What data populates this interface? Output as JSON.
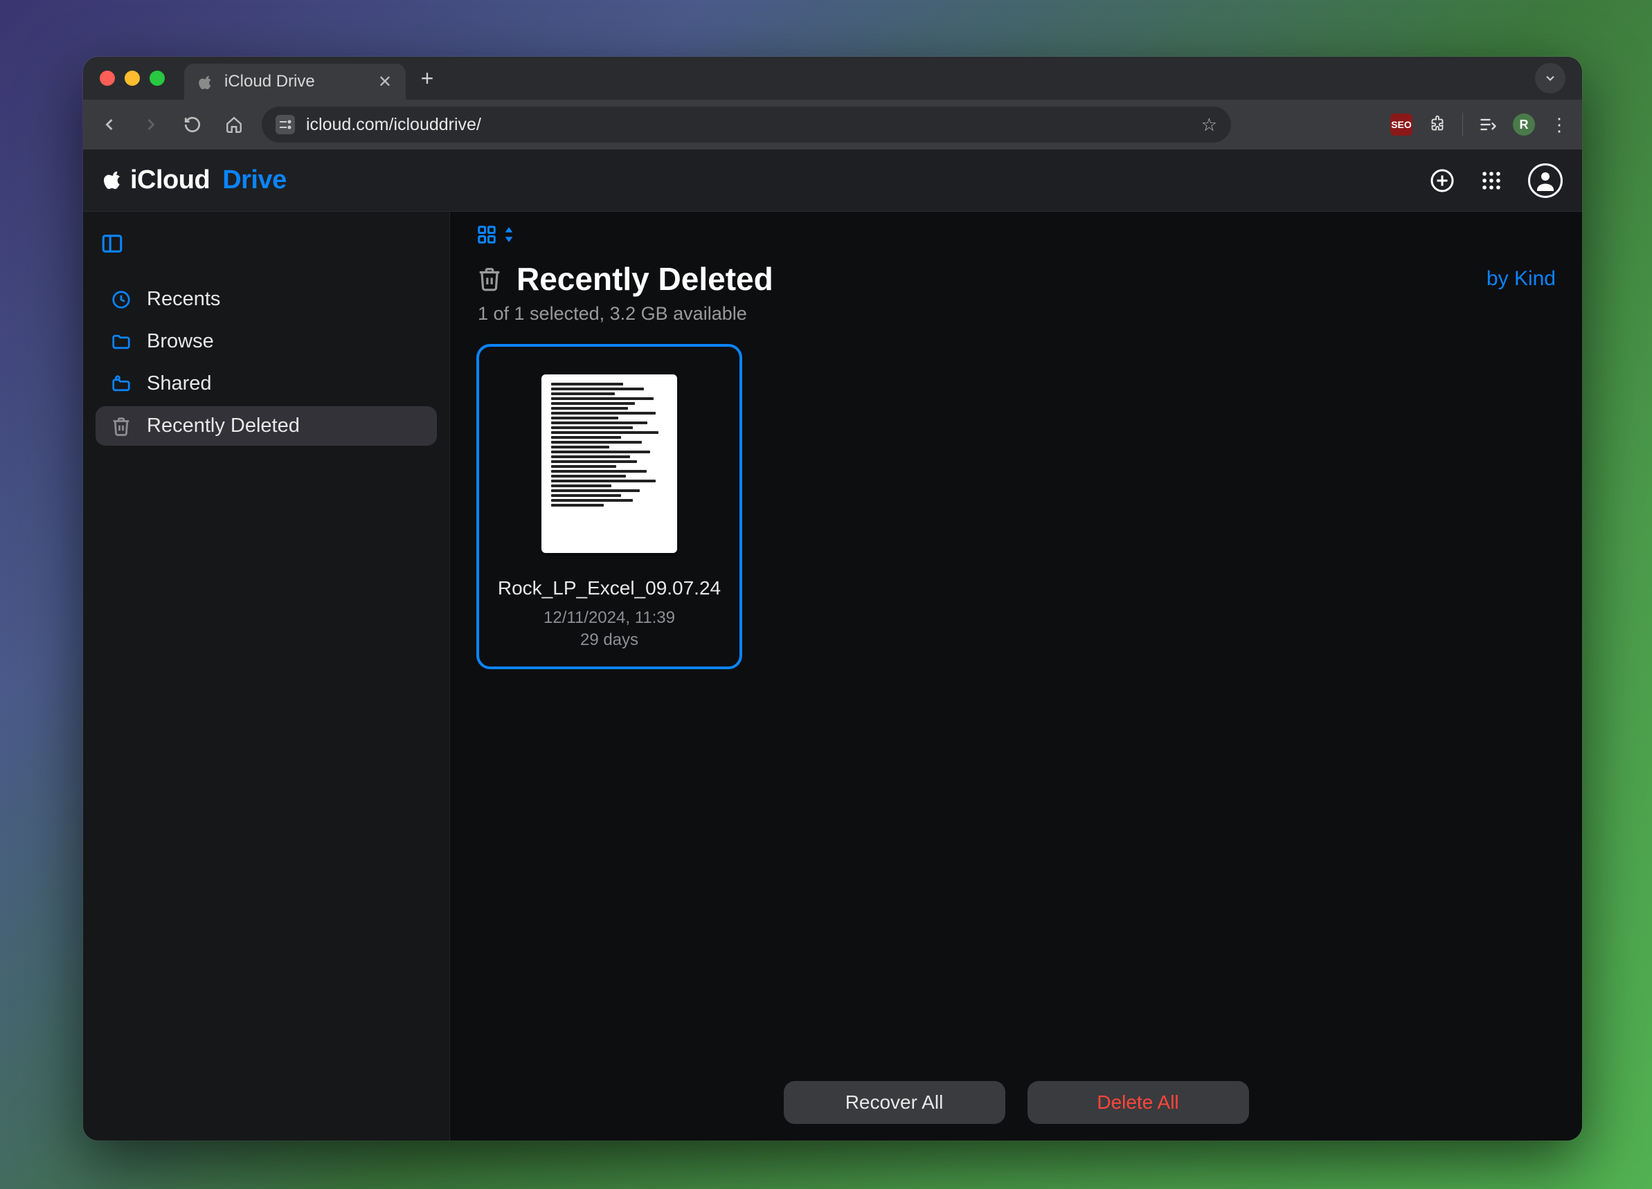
{
  "browser": {
    "tab_title": "iCloud Drive",
    "url": "icloud.com/iclouddrive/",
    "avatar_letter": "R",
    "seo_badge": "SEO"
  },
  "app": {
    "logo_primary": "iCloud",
    "logo_secondary": "Drive"
  },
  "sidebar": {
    "items": [
      {
        "label": "Recents"
      },
      {
        "label": "Browse"
      },
      {
        "label": "Shared"
      },
      {
        "label": "Recently Deleted"
      }
    ]
  },
  "main": {
    "title": "Recently Deleted",
    "sort_label": "by Kind",
    "status": "1 of 1 selected, 3.2 GB available"
  },
  "files": [
    {
      "name": "Rock_LP_Excel_09.07.24",
      "date": "12/11/2024, 11:39",
      "days": "29 days"
    }
  ],
  "footer": {
    "recover": "Recover All",
    "delete": "Delete All"
  }
}
